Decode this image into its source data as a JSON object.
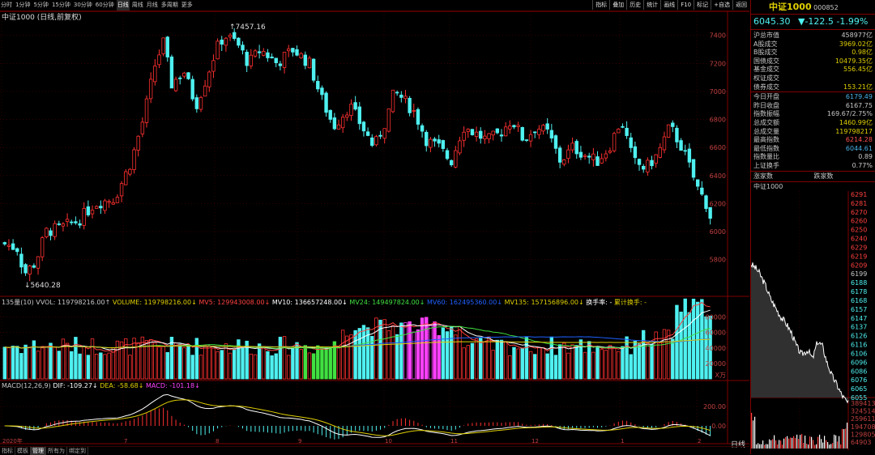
{
  "toolbar": {
    "periods": [
      "分时",
      "1分钟",
      "5分钟",
      "15分钟",
      "30分钟",
      "60分钟",
      "日线",
      "周线",
      "月线",
      "多周期",
      "更多"
    ],
    "active_period": "日线",
    "right_tools": [
      "指标",
      "叠加",
      "历史",
      "统计",
      "画线",
      "F10",
      "标记",
      "+自选",
      "返回"
    ]
  },
  "chart": {
    "title": "中证1000 (日线,前复权)",
    "high_marker": "7457.16",
    "low_marker": "5640.28",
    "y_ticks": [
      "7400",
      "7200",
      "7000",
      "6800",
      "6600",
      "6400",
      "6200",
      "6000",
      "5800"
    ],
    "x_ticks": [
      "2020年",
      "7",
      "8",
      "9",
      "10",
      "11",
      "12",
      "1",
      "2"
    ]
  },
  "volume": {
    "header_prefix": "135量(10)",
    "vvol": "VVOL: 119798216.00↑",
    "volume": "VOLUME: 119798216.00↓",
    "mv5": "MV5: 129943008.00↓",
    "mv10": "MV10: 136657248.00↓",
    "mv24": "MV24: 149497824.00↓",
    "mv60": "MV60: 162495360.00↓",
    "mv135": "MV135: 157156896.00↓",
    "turnover": "换手率: -",
    "cum_turnover": "累计换手: -",
    "y_ticks": [
      "80000",
      "60000",
      "40000",
      "20000"
    ],
    "unit": "X万"
  },
  "macd": {
    "header": "MACD(12,26,9)",
    "dif": "DIF: -109.27↓",
    "dea": "DEA: -58.68↓",
    "macd": "MACD: -101.18↓",
    "y_ticks": [
      "200.00",
      "0.00"
    ]
  },
  "bottom_tabs": [
    "指标",
    "模板",
    "管理",
    "所有为",
    "绑定到"
  ],
  "bottom_active": "管理",
  "period_label": "日线",
  "quote": {
    "name": "中证1000",
    "code": "000852",
    "price": "6045.30",
    "change": "▼-122.5",
    "pct": "-1.99%"
  },
  "market": [
    {
      "label": "沪总市值",
      "value": "458977亿",
      "color": "#c8c8c8"
    },
    {
      "label": "A股成交",
      "value": "3969.02亿",
      "color": "#e0d000"
    },
    {
      "label": "B股成交",
      "value": "0.98亿",
      "color": "#e0d000"
    },
    {
      "label": "国债成交",
      "value": "10479.35亿",
      "color": "#e0d000"
    },
    {
      "label": "基金成交",
      "value": "556.45亿",
      "color": "#e0d000"
    },
    {
      "label": "权证成交",
      "value": "",
      "color": "#e0d000"
    },
    {
      "label": "债券成交",
      "value": "153.21亿",
      "color": "#e0d000"
    }
  ],
  "stats": [
    {
      "label": "今日开盘",
      "value": "6179.49",
      "color": "#4ab0e6"
    },
    {
      "label": "昨日收盘",
      "value": "6167.75",
      "color": "#c8c8c8"
    },
    {
      "label": "指数振幅",
      "value": "169.67/2.75%",
      "color": "#c8c8c8"
    },
    {
      "label": "总成交额",
      "value": "1460.99亿",
      "color": "#e0d000"
    },
    {
      "label": "总成交量",
      "value": "119798217",
      "color": "#e0d000"
    },
    {
      "label": "最高指数",
      "value": "6214.28",
      "color": "#ff5050"
    },
    {
      "label": "最低指数",
      "value": "6044.61",
      "color": "#4ab0e6"
    },
    {
      "label": "指数量比",
      "value": "0.89",
      "color": "#c8c8c8"
    },
    {
      "label": "上证换手",
      "value": "0.77%",
      "color": "#c8c8c8"
    }
  ],
  "updown": {
    "up_label": "涨家数",
    "down_label": "跌家数"
  },
  "mini": {
    "title": "中证1000",
    "price_ticks": [
      "6291",
      "6281",
      "6270",
      "6260",
      "6250",
      "6240",
      "6229",
      "6219",
      "6209",
      "6199",
      "6188",
      "6178",
      "6168",
      "6157",
      "6147",
      "6137",
      "6126",
      "6116",
      "6106",
      "6096",
      "6086",
      "6076",
      "6065",
      "6055"
    ],
    "vol_ticks": [
      "389413",
      "324514",
      "259611",
      "194708",
      "129805",
      "64903"
    ]
  },
  "colors": {
    "up": "#ff3030",
    "down": "#4ff0f0",
    "bg": "#000000",
    "grid": "#800000"
  }
}
